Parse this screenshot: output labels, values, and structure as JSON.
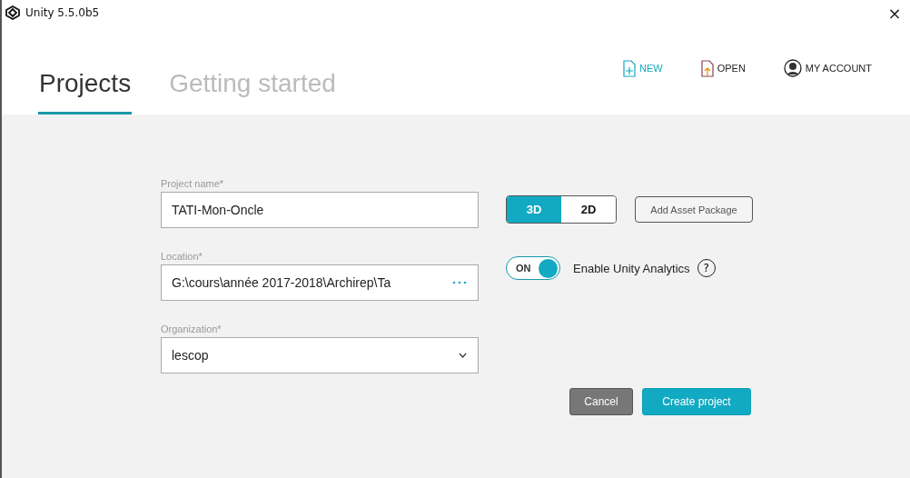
{
  "window": {
    "title": "Unity 5.5.0b5",
    "close": "×"
  },
  "tabs": [
    {
      "label": "Projects",
      "selected": true
    },
    {
      "label": "Getting started",
      "selected": false
    }
  ],
  "actions": [
    {
      "label": "NEW",
      "kind": "new"
    },
    {
      "label": "OPEN",
      "kind": "open"
    },
    {
      "label": "MY ACCOUNT",
      "kind": "account"
    }
  ],
  "fields": [
    {
      "label": "Project name*",
      "value": "TATI-Mon-Oncle",
      "kind": "text"
    },
    {
      "label": "Location*",
      "value": "G:\\cours\\année 2017-2018\\Archirep\\Ta",
      "kind": "browse"
    },
    {
      "label": "Organization*",
      "value": "lescop",
      "kind": "select"
    }
  ],
  "dimension": [
    {
      "label": "3D",
      "selected": true
    },
    {
      "label": "2D",
      "selected": false
    }
  ],
  "add_asset_button": "Add Asset Package",
  "analytics": {
    "on": true,
    "toggle_label": "ON",
    "label": "Enable Unity Analytics",
    "help": "?"
  },
  "buttons": [
    {
      "label": "Cancel",
      "kind": "secondary"
    },
    {
      "label": "Create project",
      "kind": "primary"
    }
  ]
}
